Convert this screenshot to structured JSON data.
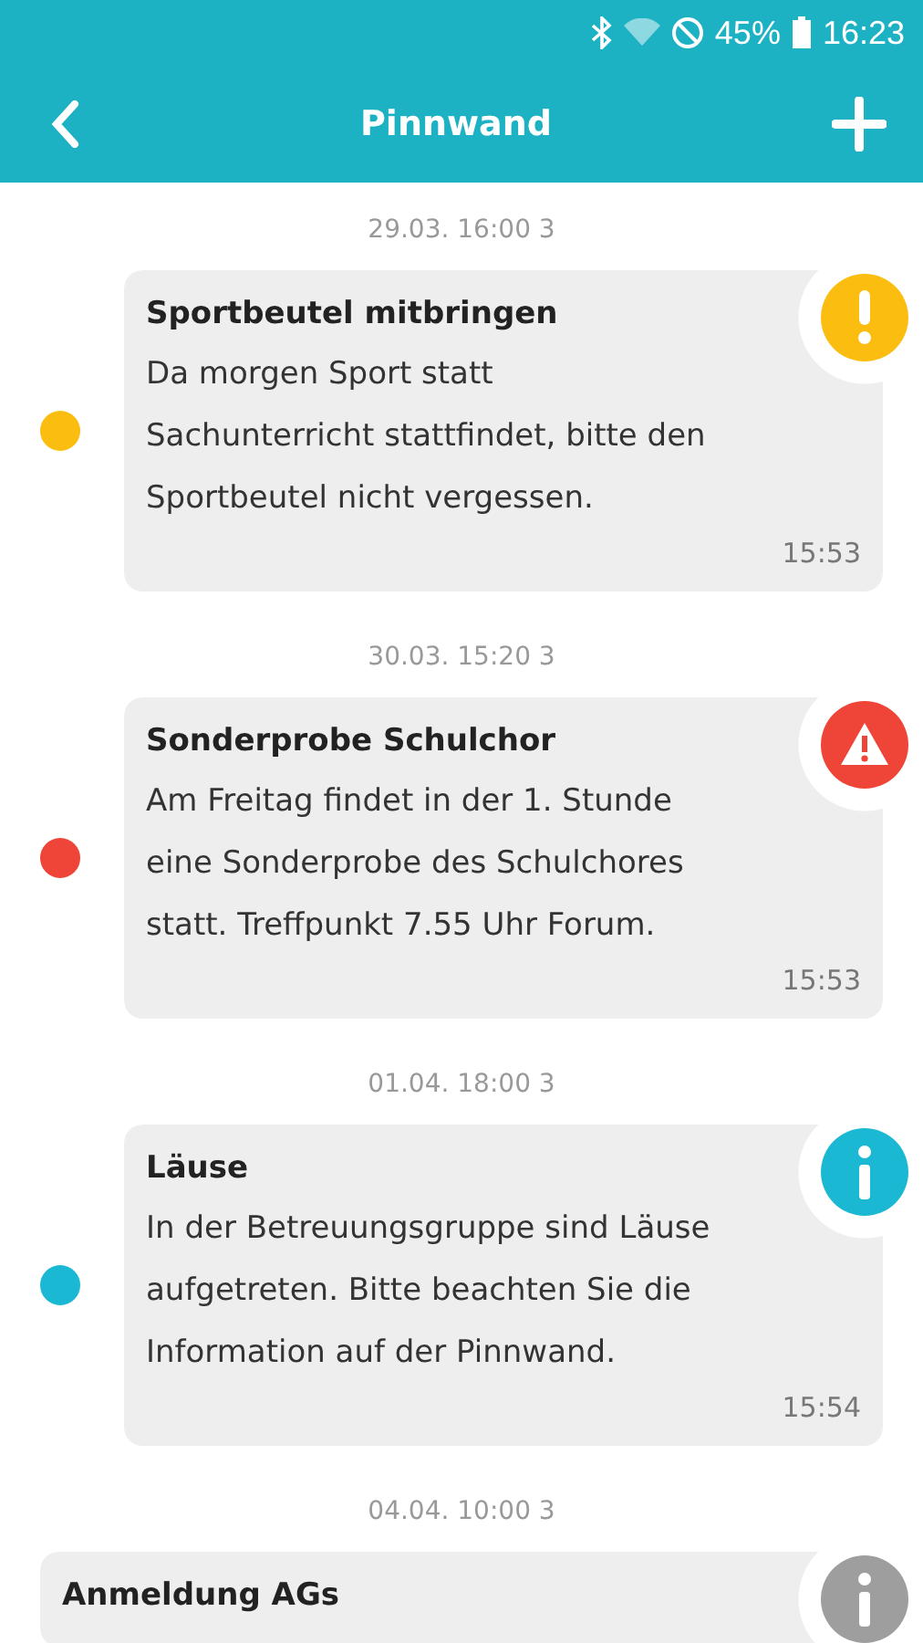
{
  "status_bar": {
    "battery": "45%",
    "time": "16:23"
  },
  "toolbar": {
    "title": "Pinnwand"
  },
  "posts": [
    {
      "timestamp": "29.03. 16:00 3",
      "title": "Sportbeutel mitbringen",
      "lines": [
        "Da morgen Sport statt",
        "Sachunterricht stattfindet, bitte den",
        "Sportbeutel nicht vergessen."
      ],
      "time": "15:53",
      "kind": "notice",
      "color": "#fbbd10",
      "unread": true
    },
    {
      "timestamp": "30.03. 15:20 3",
      "title": "Sonderprobe Schulchor",
      "lines": [
        "Am Freitag findet in der 1. Stunde",
        "eine Sonderprobe des Schulchores",
        "statt. Treffpunkt 7.55 Uhr Forum."
      ],
      "time": "15:53",
      "kind": "warning",
      "color": "#ef4538",
      "unread": true
    },
    {
      "timestamp": "01.04. 18:00 3",
      "title": "Läuse",
      "lines": [
        "In der Betreuungsgruppe sind Läuse",
        "aufgetreten. Bitte beachten Sie die",
        "Information auf der Pinnwand."
      ],
      "time": "15:54",
      "kind": "info",
      "color": "#1ab8d2",
      "unread": true
    },
    {
      "timestamp": "04.04. 10:00 3",
      "title": "Anmeldung AGs",
      "kind": "info",
      "color": "#9e9e9e",
      "unread": false
    }
  ]
}
